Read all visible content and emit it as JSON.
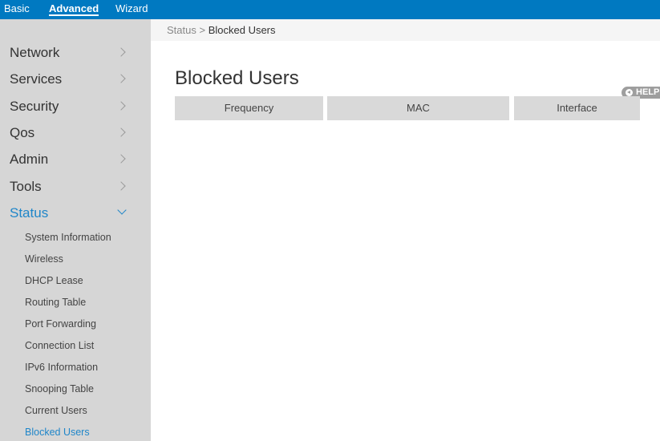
{
  "topnav": {
    "basic": "Basic",
    "advanced": "Advanced",
    "wizard": "Wizard"
  },
  "sidebar": {
    "items": [
      {
        "label": "Network"
      },
      {
        "label": "Services"
      },
      {
        "label": "Security"
      },
      {
        "label": "Qos"
      },
      {
        "label": "Admin"
      },
      {
        "label": "Tools"
      },
      {
        "label": "Status"
      }
    ],
    "status_subitems": [
      {
        "label": "System Information"
      },
      {
        "label": "Wireless"
      },
      {
        "label": "DHCP Lease"
      },
      {
        "label": "Routing Table"
      },
      {
        "label": "Port Forwarding"
      },
      {
        "label": "Connection List"
      },
      {
        "label": "IPv6 Information"
      },
      {
        "label": "Snooping Table"
      },
      {
        "label": "Current Users"
      },
      {
        "label": "Blocked Users"
      }
    ]
  },
  "breadcrumb": {
    "parent": "Status",
    "separator": ">",
    "current": "Blocked Users"
  },
  "main": {
    "title": "Blocked Users",
    "help_label": "HELP",
    "table": {
      "columns": [
        "Frequency",
        "MAC",
        "Interface"
      ]
    }
  },
  "colors": {
    "topbar": "#0079c1",
    "sidebar": "#d6d6d6",
    "accent": "#1f86c9",
    "table_header": "#d9d9d9",
    "help_badge": "#9e9e9e"
  }
}
